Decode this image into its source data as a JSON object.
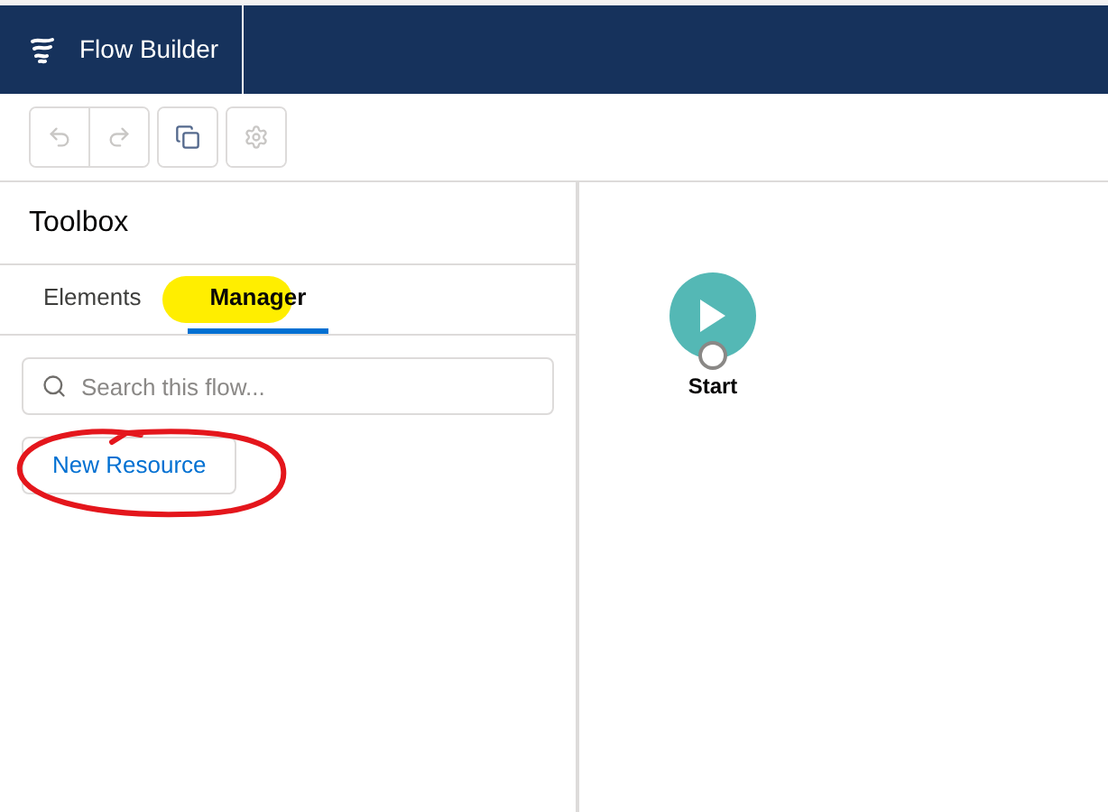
{
  "header": {
    "title": "Flow Builder"
  },
  "toolbar": {
    "buttons": [
      {
        "kind": "undo",
        "disabled": true
      },
      {
        "kind": "redo",
        "disabled": true
      },
      {
        "kind": "copy",
        "disabled": false
      },
      {
        "kind": "settings",
        "disabled": true
      }
    ]
  },
  "toolbox": {
    "title": "Toolbox",
    "tabs": [
      {
        "label": "Elements",
        "selected": false
      },
      {
        "label": "Manager",
        "selected": true
      }
    ],
    "search": {
      "placeholder": "Search this flow..."
    },
    "new_resource_button": "New Resource"
  },
  "canvas": {
    "start_node": {
      "label": "Start"
    }
  }
}
